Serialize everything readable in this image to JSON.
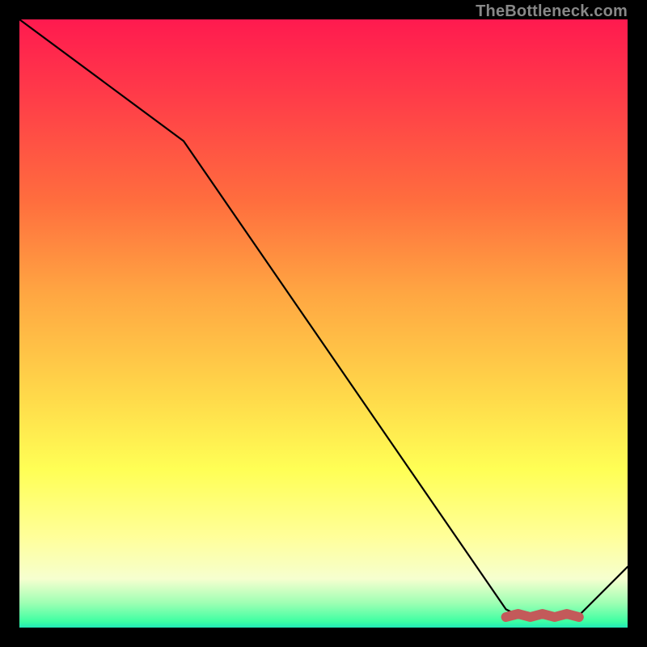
{
  "attribution": "TheBottleneck.com",
  "chart_data": {
    "type": "line",
    "title": "",
    "xlabel": "",
    "ylabel": "",
    "xlim": [
      0,
      100
    ],
    "ylim": [
      0,
      100
    ],
    "x": [
      0,
      27,
      80,
      82,
      92,
      100
    ],
    "values": [
      100,
      80,
      3,
      2,
      2,
      10
    ],
    "annotations": [
      {
        "kind": "flat-segment-marker",
        "color": "#c35a5a",
        "x_start": 80,
        "x_end": 92,
        "y": 2
      }
    ]
  }
}
